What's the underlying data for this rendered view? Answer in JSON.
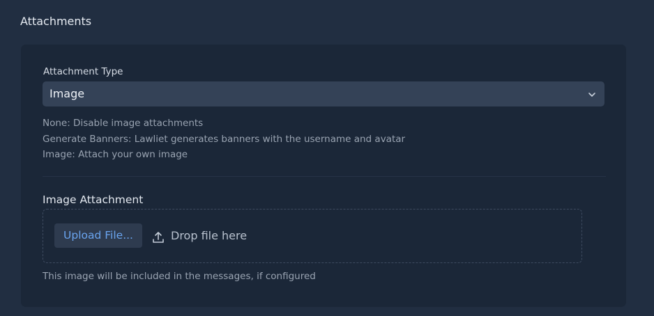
{
  "section": {
    "title": "Attachments"
  },
  "attachment_type": {
    "label": "Attachment Type",
    "selected": "Image",
    "help": [
      "None: Disable image attachments",
      "Generate Banners: Lawliet generates banners with the username and avatar",
      "Image: Attach your own image"
    ]
  },
  "image_attachment": {
    "label": "Image Attachment",
    "upload_button": "Upload File...",
    "drop_hint": "Drop file here",
    "footnote": "This image will be included in the messages, if configured"
  },
  "icons": {
    "select_arrow": "chevron-down-icon",
    "upload": "upload-icon"
  },
  "colors": {
    "background": "#212e41",
    "panel": "#1b2738",
    "select": "#344257",
    "accent": "#6aa5f0"
  }
}
